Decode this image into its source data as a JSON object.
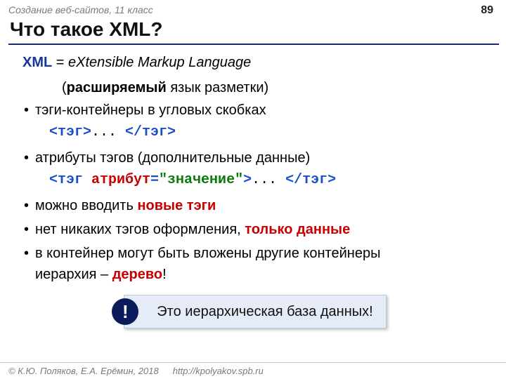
{
  "header": {
    "course": "Создание веб-сайтов, 11 класс",
    "page": "89"
  },
  "title": "Что такое XML?",
  "definition": {
    "term": "XML",
    "equals": " = ",
    "expansion": "eXtensible Markup Language",
    "sub_prefix": "(",
    "sub_bold": "расширяемый",
    "sub_rest": " язык разметки)"
  },
  "bullets": {
    "b1": "тэги-контейнеры в угловых скобках",
    "code1": {
      "open": "<тэг>",
      "mid": "... ",
      "close": "</тэг>"
    },
    "b2": "атрибуты тэгов (дополнительные данные)",
    "code2": {
      "open_lt": "<тэг ",
      "attr": "атрибут",
      "eq": "=",
      "val": "\"значение\"",
      "gt": ">",
      "mid": "... ",
      "close": "</тэг>"
    },
    "b3_pre": "можно вводить ",
    "b3_red": "новые тэги",
    "b4_pre": "нет никаких тэгов оформления, ",
    "b4_red": "только данные",
    "b5_line1": "в контейнер могут быть вложены другие контейнеры",
    "b5_line2_pre": "иерархия – ",
    "b5_line2_red": "дерево",
    "b5_line2_post": "!"
  },
  "callout": {
    "bang": "!",
    "text": "Это иерархическая база данных!"
  },
  "footer": {
    "copyright": "© К.Ю. Поляков, Е.А. Ерёмин, 2018",
    "url": "http://kpolyakov.spb.ru"
  }
}
